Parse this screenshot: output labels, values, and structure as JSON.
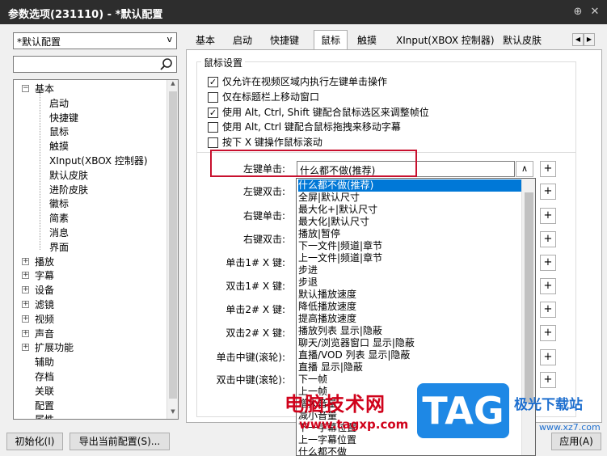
{
  "window": {
    "title": "参数选项(231110) - *默认配置",
    "pin_icon": "pin-icon",
    "close_icon": "close-icon"
  },
  "sidebar": {
    "preset": "*默认配置",
    "search_placeholder": "",
    "tree": [
      {
        "label": "基本",
        "level": 0,
        "expanded": true
      },
      {
        "label": "启动",
        "level": 1
      },
      {
        "label": "快捷键",
        "level": 1
      },
      {
        "label": "鼠标",
        "level": 1
      },
      {
        "label": "触摸",
        "level": 1
      },
      {
        "label": "XInput(XBOX 控制器)",
        "level": 1
      },
      {
        "label": "默认皮肤",
        "level": 1
      },
      {
        "label": "进阶皮肤",
        "level": 1
      },
      {
        "label": "徽标",
        "level": 1
      },
      {
        "label": "简素",
        "level": 1
      },
      {
        "label": "消息",
        "level": 1
      },
      {
        "label": "界面",
        "level": 1
      },
      {
        "label": "播放",
        "level": 0,
        "expanded": false
      },
      {
        "label": "字幕",
        "level": 0,
        "expanded": false
      },
      {
        "label": "设备",
        "level": 0,
        "expanded": false
      },
      {
        "label": "滤镜",
        "level": 0,
        "expanded": false
      },
      {
        "label": "视频",
        "level": 0,
        "expanded": false
      },
      {
        "label": "声音",
        "level": 0,
        "expanded": false
      },
      {
        "label": "扩展功能",
        "level": 0,
        "expanded": false
      },
      {
        "label": "辅助",
        "level": 0
      },
      {
        "label": "存档",
        "level": 0
      },
      {
        "label": "关联",
        "level": 0
      },
      {
        "label": "配置",
        "level": 0
      },
      {
        "label": "属性",
        "level": 0
      }
    ]
  },
  "tabs": [
    "基本",
    "启动",
    "快捷键",
    "鼠标",
    "触摸",
    "XInput(XBOX 控制器)",
    "默认皮肤"
  ],
  "active_tab": "鼠标",
  "mouse": {
    "group_label": "鼠标设置",
    "options": [
      {
        "label": "仅允许在视频区域内执行左键单击操作",
        "checked": true
      },
      {
        "label": "仅在标题栏上移动窗口",
        "checked": false
      },
      {
        "label": "使用 Alt, Ctrl, Shift 键配合鼠标选区来调整帧位",
        "checked": true
      },
      {
        "label": "使用 Alt, Ctrl 键配合鼠标拖拽来移动字幕",
        "checked": false
      },
      {
        "label": "按下 X 键操作鼠标滚动",
        "checked": false
      }
    ],
    "actions": [
      {
        "label": "左键单击:",
        "value": "什么都不做(推荐)"
      },
      {
        "label": "左键双击:",
        "value": ""
      },
      {
        "label": "右键单击:",
        "value": ""
      },
      {
        "label": "右键双击:",
        "value": ""
      },
      {
        "label": "单击1# X 键:",
        "value": ""
      },
      {
        "label": "双击1# X 键:",
        "value": ""
      },
      {
        "label": "单击2# X 键:",
        "value": ""
      },
      {
        "label": "双击2# X 键:",
        "value": ""
      },
      {
        "label": "单击中键(滚轮):",
        "value": ""
      },
      {
        "label": "双击中键(滚轮):",
        "value": ""
      }
    ],
    "combo_arrow": "∧",
    "plus": "+"
  },
  "dropdown": [
    "什么都不做(推荐)",
    "全屏|默认尺寸",
    "最大化+|默认尺寸",
    "最大化|默认尺寸",
    "播放|暂停",
    "下一文件|频道|章节",
    "上一文件|频道|章节",
    "步进",
    "步退",
    "默认播放速度",
    "降低播放速度",
    "提高播放速度",
    "播放列表 显示|隐蔽",
    "聊天/浏览器窗口 显示|隐蔽",
    "直播/VOD 列表 显示|隐蔽",
    "直播 显示|隐蔽",
    "下一帧",
    "上一帧",
    "增大音量",
    "减小音量",
    "下一字幕位置",
    "上一字幕位置",
    "什么都不做"
  ],
  "footer": {
    "reset": "初始化(I)",
    "export": "导出当前配置(S)...",
    "apply": "应用(A)"
  },
  "watermark": {
    "site_cn": "电脑技术网",
    "site_url": "www.tagxp.com",
    "tag": "TAG",
    "brand": "极光下载站",
    "brand_url": "www.xz7.com"
  },
  "colors": {
    "highlight": "#c8102e",
    "selection": "#0078d7",
    "title_bg": "#2d2d2d"
  }
}
